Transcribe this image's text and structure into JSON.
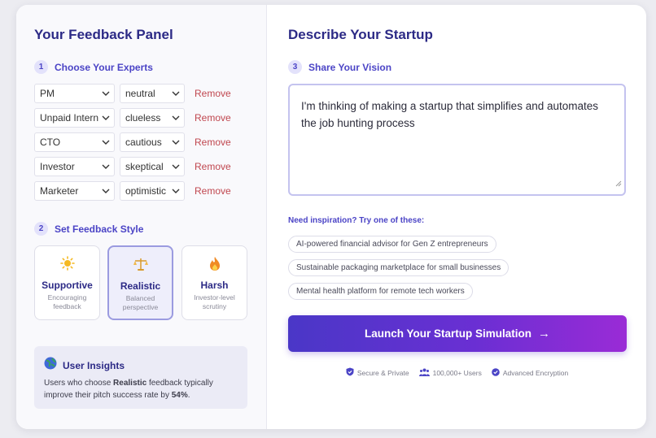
{
  "left_panel": {
    "title": "Your Feedback Panel",
    "step1": {
      "num": "1",
      "label": "Choose Your Experts"
    },
    "experts": [
      {
        "role": "PM",
        "mood": "neutral",
        "remove": "Remove"
      },
      {
        "role": "Unpaid Intern",
        "mood": "clueless",
        "remove": "Remove"
      },
      {
        "role": "CTO",
        "mood": "cautious",
        "remove": "Remove"
      },
      {
        "role": "Investor",
        "mood": "skeptical",
        "remove": "Remove"
      },
      {
        "role": "Marketer",
        "mood": "optimistic",
        "remove": "Remove"
      }
    ],
    "step2": {
      "num": "2",
      "label": "Set Feedback Style"
    },
    "styles": [
      {
        "name": "Supportive",
        "desc": "Encouraging feedback",
        "icon": "sun-icon",
        "selected": false
      },
      {
        "name": "Realistic",
        "desc": "Balanced perspective",
        "icon": "scale-icon",
        "selected": true
      },
      {
        "name": "Harsh",
        "desc": "Investor-level scrutiny",
        "icon": "fire-icon",
        "selected": false
      }
    ],
    "insights": {
      "title": "User Insights",
      "text_before": "Users who choose ",
      "highlight": "Realistic",
      "text_middle": " feedback typically improve their pitch success rate by ",
      "percent": "54%",
      "text_after": "."
    }
  },
  "right_panel": {
    "title": "Describe Your Startup",
    "step3": {
      "num": "3",
      "label": "Share Your Vision"
    },
    "vision_text": "I'm thinking of making a startup that simplifies and automates the job hunting process",
    "inspiration_label": "Need inspiration? Try one of these:",
    "suggestions": [
      "AI-powered financial advisor for Gen Z entrepreneurs",
      "Sustainable packaging marketplace for small businesses",
      "Mental health platform for remote tech workers"
    ],
    "launch_label": "Launch Your Startup Simulation",
    "launch_arrow": "→",
    "footer": [
      {
        "label": "Secure & Private",
        "icon": "shield-check-icon"
      },
      {
        "label": "100,000+ Users",
        "icon": "users-icon"
      },
      {
        "label": "Advanced Encryption",
        "icon": "check-badge-icon"
      }
    ]
  },
  "colors": {
    "primary": "#2c2a86",
    "accent": "#4b44c6",
    "remove": "#c0474f",
    "button_start": "#4a37c7",
    "button_end": "#9a2bd6"
  }
}
